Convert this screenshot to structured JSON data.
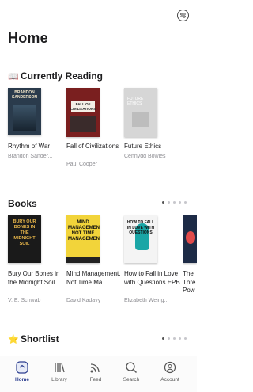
{
  "header": {
    "title": "Home",
    "top_icon": "sliders-icon"
  },
  "currently_reading": {
    "emoji": "📖",
    "title": "Currently Reading",
    "books": [
      {
        "title": "Rhythm of War",
        "author": "Brandon Sander...",
        "cover_text": "BRANDON SANDERSON",
        "cover_color": "#2a3b4c"
      },
      {
        "title": "Fall of Civilizations",
        "author": "Paul Cooper",
        "cover_text": "FALL OF CIVILIZATIONS",
        "cover_color": "#7a1f1f"
      },
      {
        "title": "Future Ethics",
        "author": "Cennydd Bowles",
        "cover_text": "FUTURE ETHICS",
        "cover_color": "#d6d6d6"
      }
    ]
  },
  "books_section": {
    "title": "Books",
    "books": [
      {
        "title": "Bury Our Bones in the Midnight Soil",
        "author": "V. E. Schwab",
        "cover_text": "BURY OUR BONES IN THE MIDNIGHT SOIL",
        "cover_color": "#1a1a1a"
      },
      {
        "title": "Mind Management, Not Time Ma...",
        "author": "David Kadavy",
        "cover_text": "MIND MANAGEMENT, NOT TIME MANAGEMENT",
        "cover_color": "#f2d43a"
      },
      {
        "title": "How to Fall in Love with Questions EPB",
        "author": "Elizabeth Weing...",
        "cover_text": "HOW TO FALL IN LOVE WITH QUESTIONS",
        "cover_color": "#f4f4f4"
      },
      {
        "title": "The Thre Pow",
        "author": "",
        "cover_text": "",
        "cover_color": "#1d2b46"
      }
    ]
  },
  "shortlist": {
    "emoji": "⭐",
    "title": "Shortlist"
  },
  "tabbar": {
    "tabs": [
      {
        "label": "Home",
        "icon": "home-icon"
      },
      {
        "label": "Library",
        "icon": "library-icon"
      },
      {
        "label": "Feed",
        "icon": "feed-icon"
      },
      {
        "label": "Search",
        "icon": "search-icon"
      },
      {
        "label": "Account",
        "icon": "account-icon"
      }
    ],
    "active_color": "#2c3e8f"
  }
}
